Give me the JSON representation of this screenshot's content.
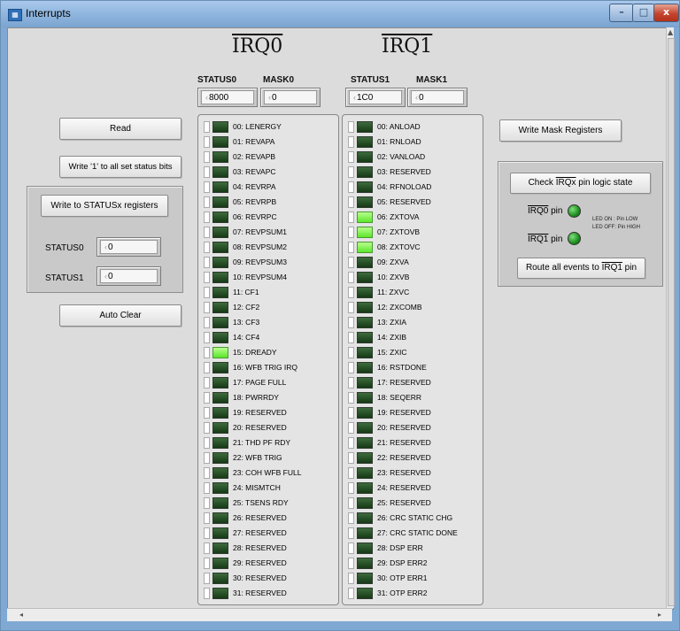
{
  "window": {
    "title": "Interrupts",
    "min": "–",
    "max": "□",
    "close": "x"
  },
  "irq0": {
    "title_prefix": "IRQ",
    "title_num": "0",
    "status_label": "STATUS0",
    "mask_label": "MASK0",
    "status_value": "8000",
    "mask_value": "0"
  },
  "irq1": {
    "title_prefix": "IRQ",
    "title_num": "1",
    "status_label": "STATUS1",
    "mask_label": "MASK1",
    "status_value": "1C0",
    "mask_value": "0"
  },
  "left": {
    "read_label": "Read",
    "write1_label": "Write '1' to all set status bits",
    "write_status_label": "Write to STATUSx registers",
    "status0_label": "STATUS0",
    "status0_value": "0",
    "status1_label": "STATUS1",
    "status1_value": "0",
    "auto_clear_label": "Auto Clear"
  },
  "right": {
    "write_mask_label": "Write Mask Registers",
    "check_prefix": "Check ",
    "check_irqx": "IRQx",
    "check_suffix": " pin logic state",
    "irq0_pin_prefix": "IRQ0",
    "irq1_pin_prefix": "IRQ1",
    "pin_suffix": " pin",
    "led_on_text": "LED ON : Pin LOW",
    "led_off_text": "LED OFF: Pin HIGH",
    "route_prefix": "Route all events to ",
    "route_irq": "IRQ1",
    "route_suffix": " pin"
  },
  "irq0_bits": [
    "00: LENERGY",
    "01: REVAPA",
    "02: REVAPB",
    "03: REVAPC",
    "04: REVRPA",
    "05: REVRPB",
    "06: REVRPC",
    "07: REVPSUM1",
    "08: REVPSUM2",
    "09: REVPSUM3",
    "10: REVPSUM4",
    "11: CF1",
    "12: CF2",
    "13: CF3",
    "14: CF4",
    "15: DREADY",
    "16: WFB TRIG IRQ",
    "17: PAGE FULL",
    "18: PWRRDY",
    "19: RESERVED",
    "20: RESERVED",
    "21: THD PF RDY",
    "22: WFB TRIG",
    "23: COH WFB FULL",
    "24: MISMTCH",
    "25: TSENS RDY",
    "26: RESERVED",
    "27: RESERVED",
    "28: RESERVED",
    "29: RESERVED",
    "30: RESERVED",
    "31: RESERVED"
  ],
  "irq1_bits": [
    "00: ANLOAD",
    "01: RNLOAD",
    "02: VANLOAD",
    "03: RESERVED",
    "04: RFNOLOAD",
    "05: RESERVED",
    "06: ZXTOVA",
    "07: ZXTOVB",
    "08: ZXTOVC",
    "09: ZXVA",
    "10: ZXVB",
    "11: ZXVC",
    "12: ZXCOMB",
    "13: ZXIA",
    "14: ZXIB",
    "15: ZXIC",
    "16: RSTDONE",
    "17: RESERVED",
    "18: SEQERR",
    "19: RESERVED",
    "20: RESERVED",
    "21: RESERVED",
    "22: RESERVED",
    "23: RESERVED",
    "24: RESERVED",
    "25: RESERVED",
    "26: CRC STATIC CHG",
    "27: CRC STATIC DONE",
    "28: DSP ERR",
    "29: DSP ERR2",
    "30: OTP ERR1",
    "31: OTP ERR2"
  ],
  "irq0_on": [
    15
  ],
  "irq1_on": [
    6,
    7,
    8
  ]
}
